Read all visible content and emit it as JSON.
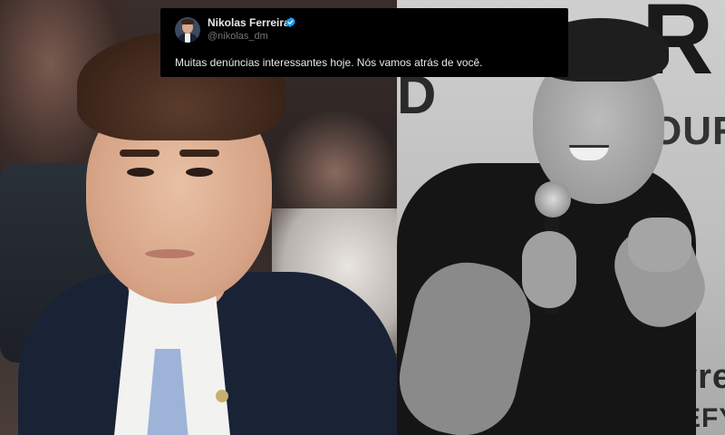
{
  "tweet": {
    "author_name": "Nikolas Ferreira",
    "handle": "@nikolas_dm",
    "verified_icon": "verified-badge-icon",
    "verified_color": "#1d9bf0",
    "text": "Muitas denúncias interessantes hoje. Nós vamos atrás de você."
  },
  "right_photo": {
    "poster_fragments": [
      "R",
      "OUR",
      "yre",
      "EFY.C",
      "D"
    ]
  }
}
